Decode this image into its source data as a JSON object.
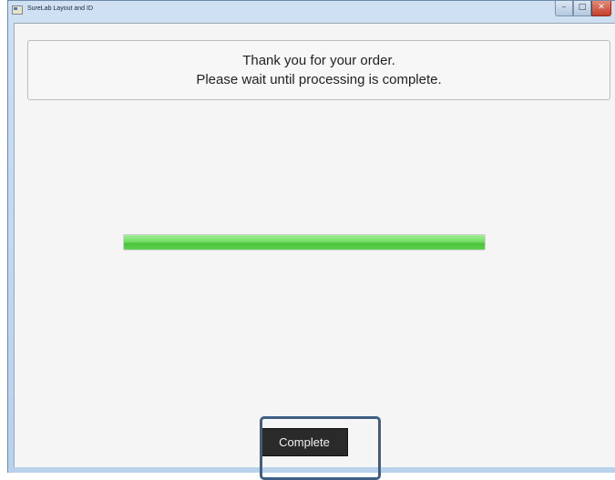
{
  "window": {
    "title": "SureLab Layout and ID",
    "controls": {
      "minimize": "–",
      "maximize": "□",
      "close": "✕"
    }
  },
  "message": {
    "line1": "Thank you for your order.",
    "line2": "Please wait until processing is complete."
  },
  "progress": {
    "value": 1.0
  },
  "buttons": {
    "complete_label": "Complete"
  },
  "colors": {
    "progress_fill": "#6fdc5f",
    "button_bg": "#2a2a2a",
    "highlight": "#3e5f83"
  }
}
